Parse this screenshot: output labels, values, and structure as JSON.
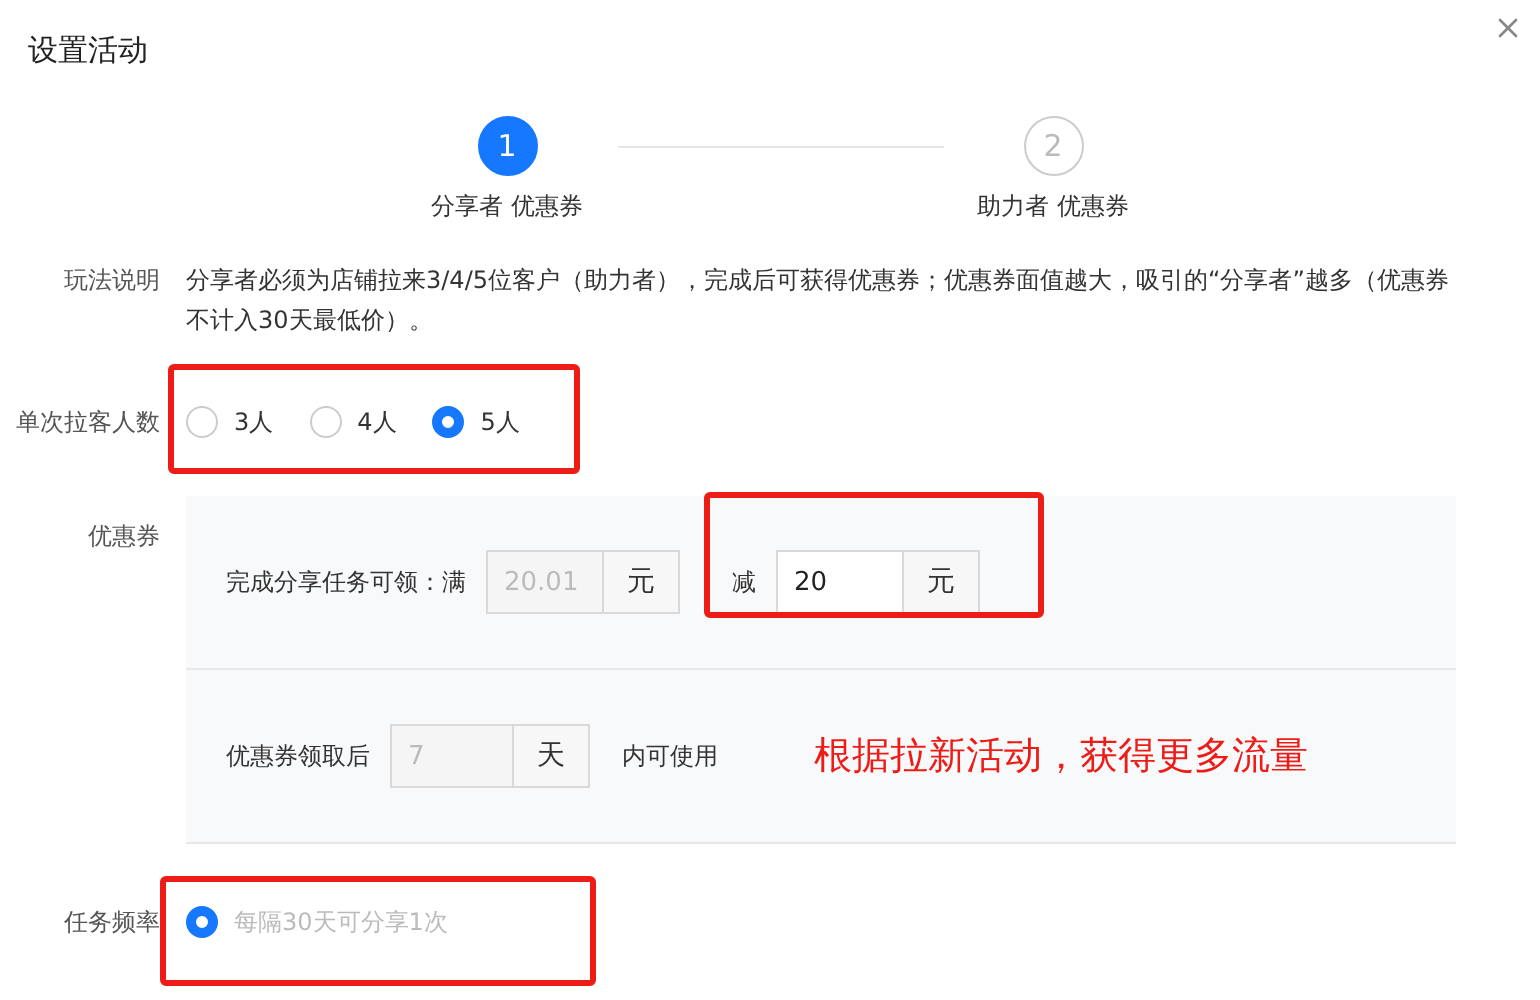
{
  "dialog": {
    "title": "设置活动"
  },
  "steps": [
    {
      "number": "1",
      "label": "分享者 优惠券",
      "selected": true
    },
    {
      "number": "2",
      "label": "助力者 优惠券",
      "selected": false
    }
  ],
  "rules": {
    "label": "玩法说明",
    "text": "分享者必须为店铺拉来3/4/5位客户（助力者），完成后可获得优惠券；优惠券面值越大，吸引的“分享者”越多（优惠券不计入30天最低价）。"
  },
  "group_size": {
    "label": "单次拉客人数",
    "options": [
      {
        "label": "3人",
        "selected": false
      },
      {
        "label": "4人",
        "selected": false
      },
      {
        "label": "5人",
        "selected": true
      }
    ]
  },
  "coupon": {
    "label": "优惠券",
    "threshold_prefix": "完成分享任务可领：满",
    "threshold": {
      "value": "20.01",
      "unit": "元",
      "disabled": true
    },
    "discount_prefix": "减",
    "discount": {
      "value": "20",
      "unit": "元",
      "disabled": false
    },
    "validity_prefix": "优惠券领取后",
    "validity": {
      "value": "7",
      "unit": "天",
      "disabled": true
    },
    "validity_suffix": "内可使用"
  },
  "frequency": {
    "label": "任务频率",
    "options": [
      {
        "label": "每隔30天可分享1次",
        "selected": true,
        "disabled": true
      }
    ]
  },
  "annotation": {
    "text": "根据拉新活动，获得更多流量"
  }
}
